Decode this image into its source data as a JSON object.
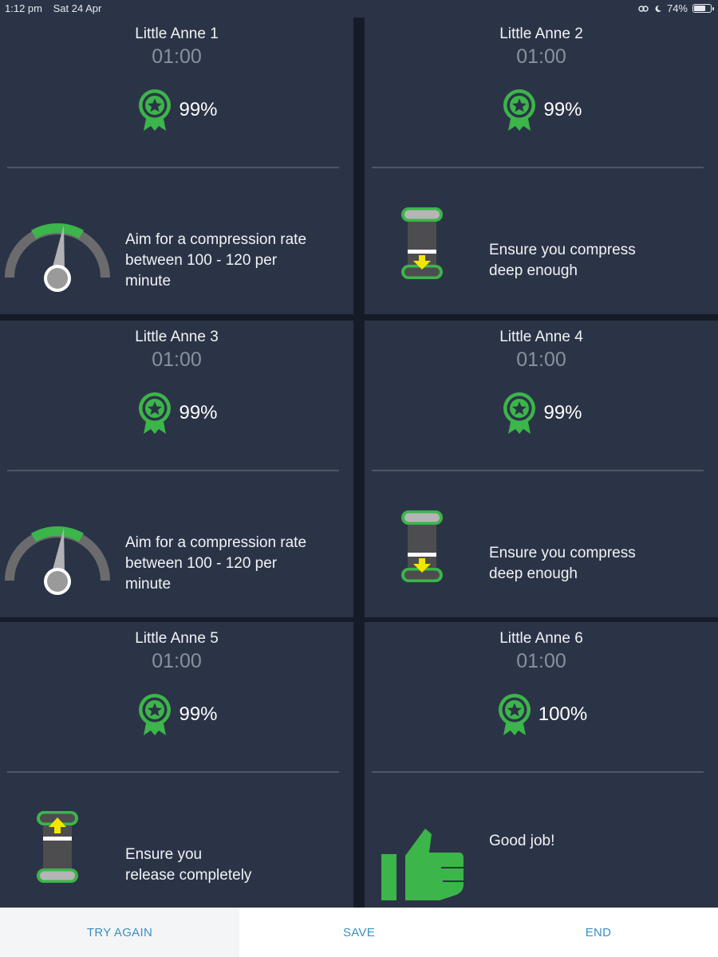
{
  "status_bar": {
    "time": "1:12 pm",
    "date": "Sat 24 Apr",
    "battery": "74%",
    "battery_level": 0.74
  },
  "colors": {
    "card": "#2b3446",
    "accent_green": "#3cb54a",
    "timer_grey": "#8a909c",
    "button_blue": "#3a8fc4",
    "arrow_yellow": "#f2e600"
  },
  "cards": [
    {
      "name": "Little Anne 1",
      "time": "01:00",
      "score": "99%",
      "feedback": {
        "icon": "speedometer-icon",
        "text": "Aim for a compression rate\nbetween 100 - 120 per\nminute"
      }
    },
    {
      "name": "Little Anne 2",
      "time": "01:00",
      "score": "99%",
      "feedback": {
        "icon": "compression-depth-icon",
        "text": "Ensure you compress\ndeep enough"
      }
    },
    {
      "name": "Little Anne 3",
      "time": "01:00",
      "score": "99%",
      "feedback": {
        "icon": "speedometer-icon",
        "text": "Aim for a compression rate\nbetween 100 - 120 per\nminute"
      }
    },
    {
      "name": "Little Anne 4",
      "time": "01:00",
      "score": "99%",
      "feedback": {
        "icon": "compression-depth-icon",
        "text": "Ensure you compress\ndeep enough"
      }
    },
    {
      "name": "Little Anne 5",
      "time": "01:00",
      "score": "99%",
      "feedback": {
        "icon": "release-icon",
        "text": "Ensure you\nrelease completely"
      }
    },
    {
      "name": "Little Anne 6",
      "time": "01:00",
      "score": "100%",
      "feedback": {
        "icon": "thumbs-up-icon",
        "text": "Good job!"
      }
    }
  ],
  "footer": {
    "try_again": "TRY AGAIN",
    "save": "SAVE",
    "end": "END"
  }
}
